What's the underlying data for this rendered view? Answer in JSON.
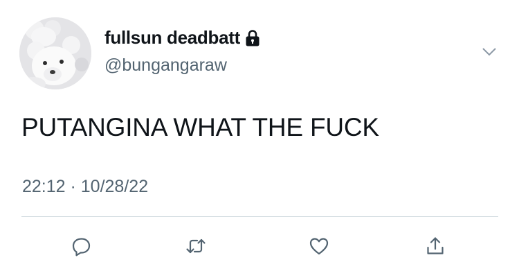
{
  "tweet": {
    "display_name": "fullsun deadbatt",
    "handle": "@bungangaraw",
    "text": "PUTANGINA WHAT THE FUCK",
    "timestamp": "22:12 · 10/28/22",
    "protected_icon": "lock-icon",
    "avatar_icon": "teddy-bear-avatar"
  },
  "actions": {
    "reply_icon": "reply-icon",
    "retweet_icon": "retweet-icon",
    "like_icon": "heart-icon",
    "share_icon": "share-icon",
    "more_icon": "chevron-down-icon"
  },
  "colors": {
    "text_primary": "#0f1419",
    "text_secondary": "#536471",
    "divider": "#cfd9de",
    "icon": "#536471"
  }
}
